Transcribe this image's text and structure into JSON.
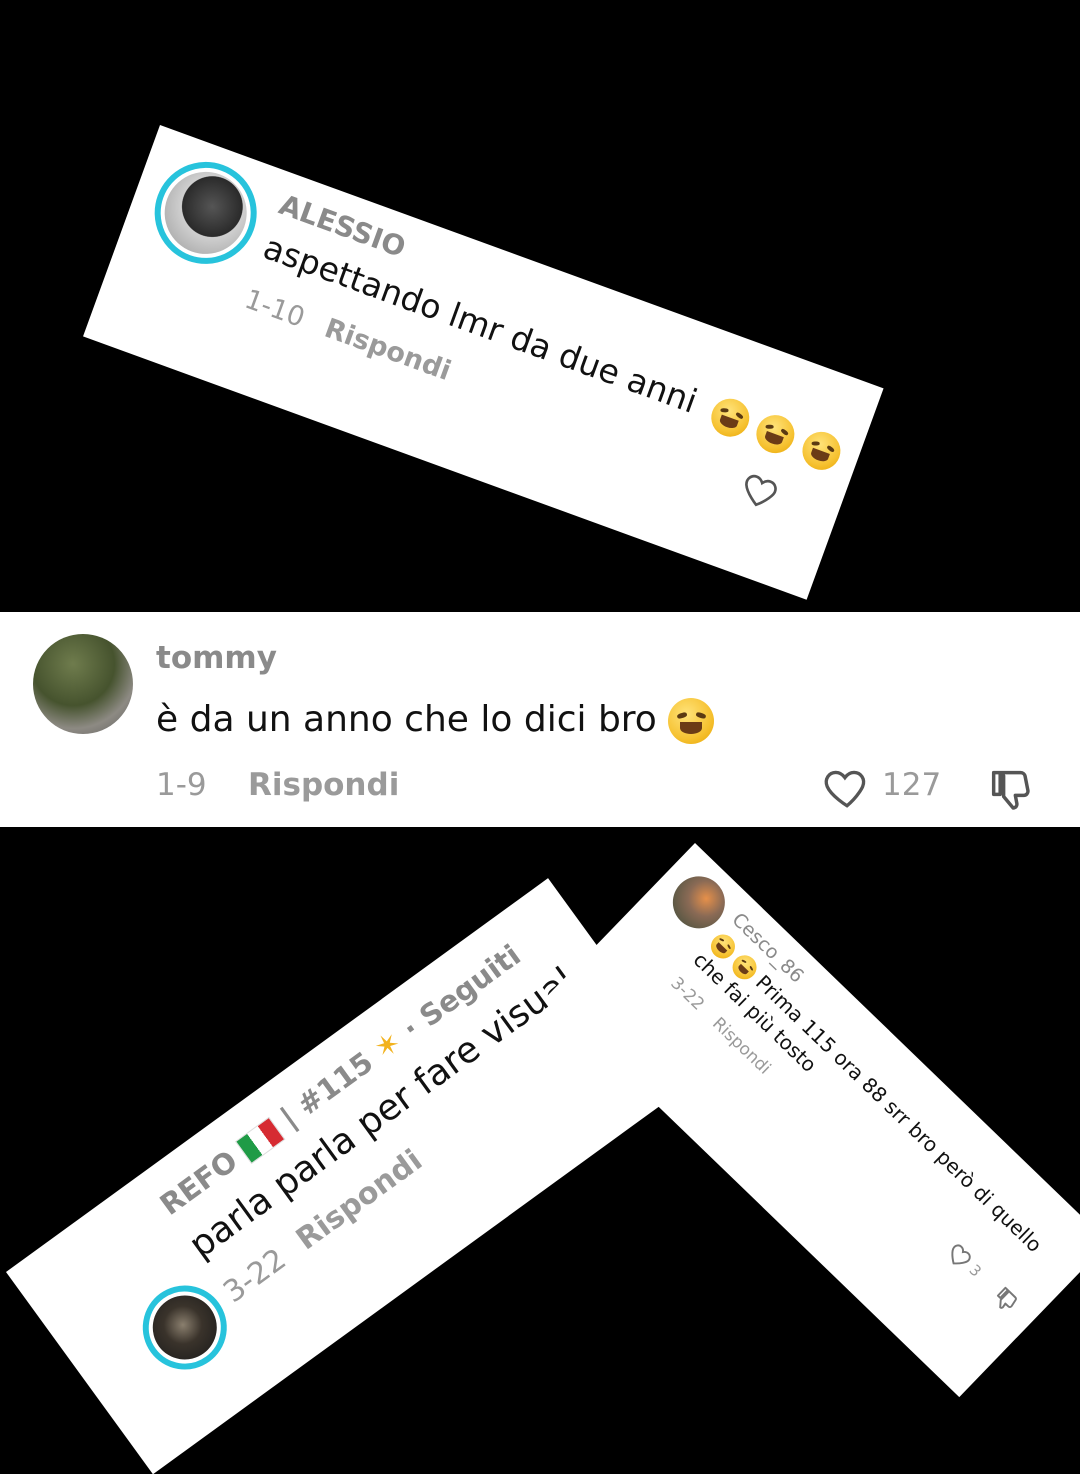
{
  "comments": [
    {
      "id": "alessio",
      "username": "ALESSIO",
      "text": "aspettando lmr da due anni",
      "date": "1-10",
      "reply_label": "Rispondi",
      "emoji_count": 3
    },
    {
      "id": "tommy",
      "username": "tommy",
      "text": "è da un anno che lo dici bro",
      "date": "1-9",
      "reply_label": "Rispondi",
      "likes": "127",
      "emoji_count": 1
    },
    {
      "id": "refo",
      "username": "REFO",
      "username_suffix": "| #115",
      "follow_label": "· Seguiti",
      "text": "parla parla per fare visual",
      "date": "3-22",
      "reply_label": "Rispondi"
    },
    {
      "id": "cesco",
      "username": "Cesco_86",
      "text": "Prima 115 ora 88 srr bro però di quello",
      "text_line2": "che fai più tosto",
      "date": "3-22",
      "reply_label": "Rispondi",
      "likes": "3",
      "emoji_count": 2
    }
  ],
  "colors": {
    "background": "#000000",
    "card": "#ffffff",
    "story_ring": "#27c3dc",
    "muted_text": "#8a8a8a"
  },
  "icons": [
    "heart-icon",
    "dislike-icon",
    "laughing-emoji-icon",
    "italy-flag-icon",
    "dizzy-star-icon"
  ]
}
